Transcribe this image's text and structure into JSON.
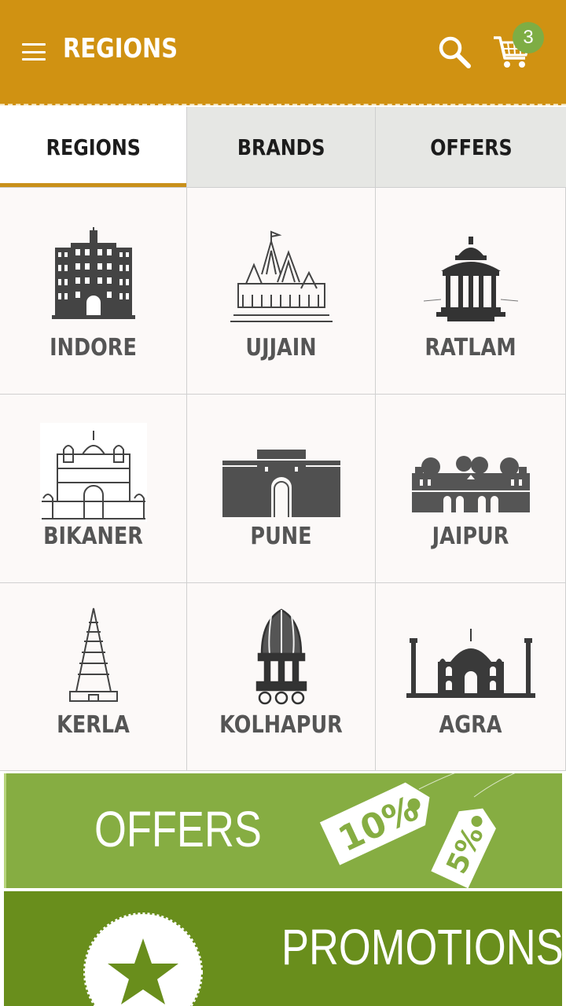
{
  "appbar": {
    "title": "REGIONS",
    "cart_count": "3",
    "color": "#d09212"
  },
  "tabs": [
    {
      "label": "REGIONS",
      "active": true
    },
    {
      "label": "BRANDS",
      "active": false
    },
    {
      "label": "OFFERS",
      "active": false
    }
  ],
  "regions": [
    {
      "label": "INDORE",
      "icon": "palace-icon"
    },
    {
      "label": "UJJAIN",
      "icon": "temple-icon"
    },
    {
      "label": "RATLAM",
      "icon": "pavilion-icon"
    },
    {
      "label": "BIKANER",
      "icon": "fort-gate-icon"
    },
    {
      "label": "PUNE",
      "icon": "fort-wall-icon"
    },
    {
      "label": "JAIPUR",
      "icon": "trees-palace-icon"
    },
    {
      "label": "KERLA",
      "icon": "gopuram-icon"
    },
    {
      "label": "KOLHAPUR",
      "icon": "chariot-icon"
    },
    {
      "label": "AGRA",
      "icon": "taj-mahal-icon"
    }
  ],
  "banners": {
    "offers": {
      "label": "OFFERS",
      "tag1": "10%",
      "tag2": "5%",
      "color": "#86ad42"
    },
    "promotions": {
      "label": "PROMOTIONS",
      "color": "#698e1c"
    }
  }
}
